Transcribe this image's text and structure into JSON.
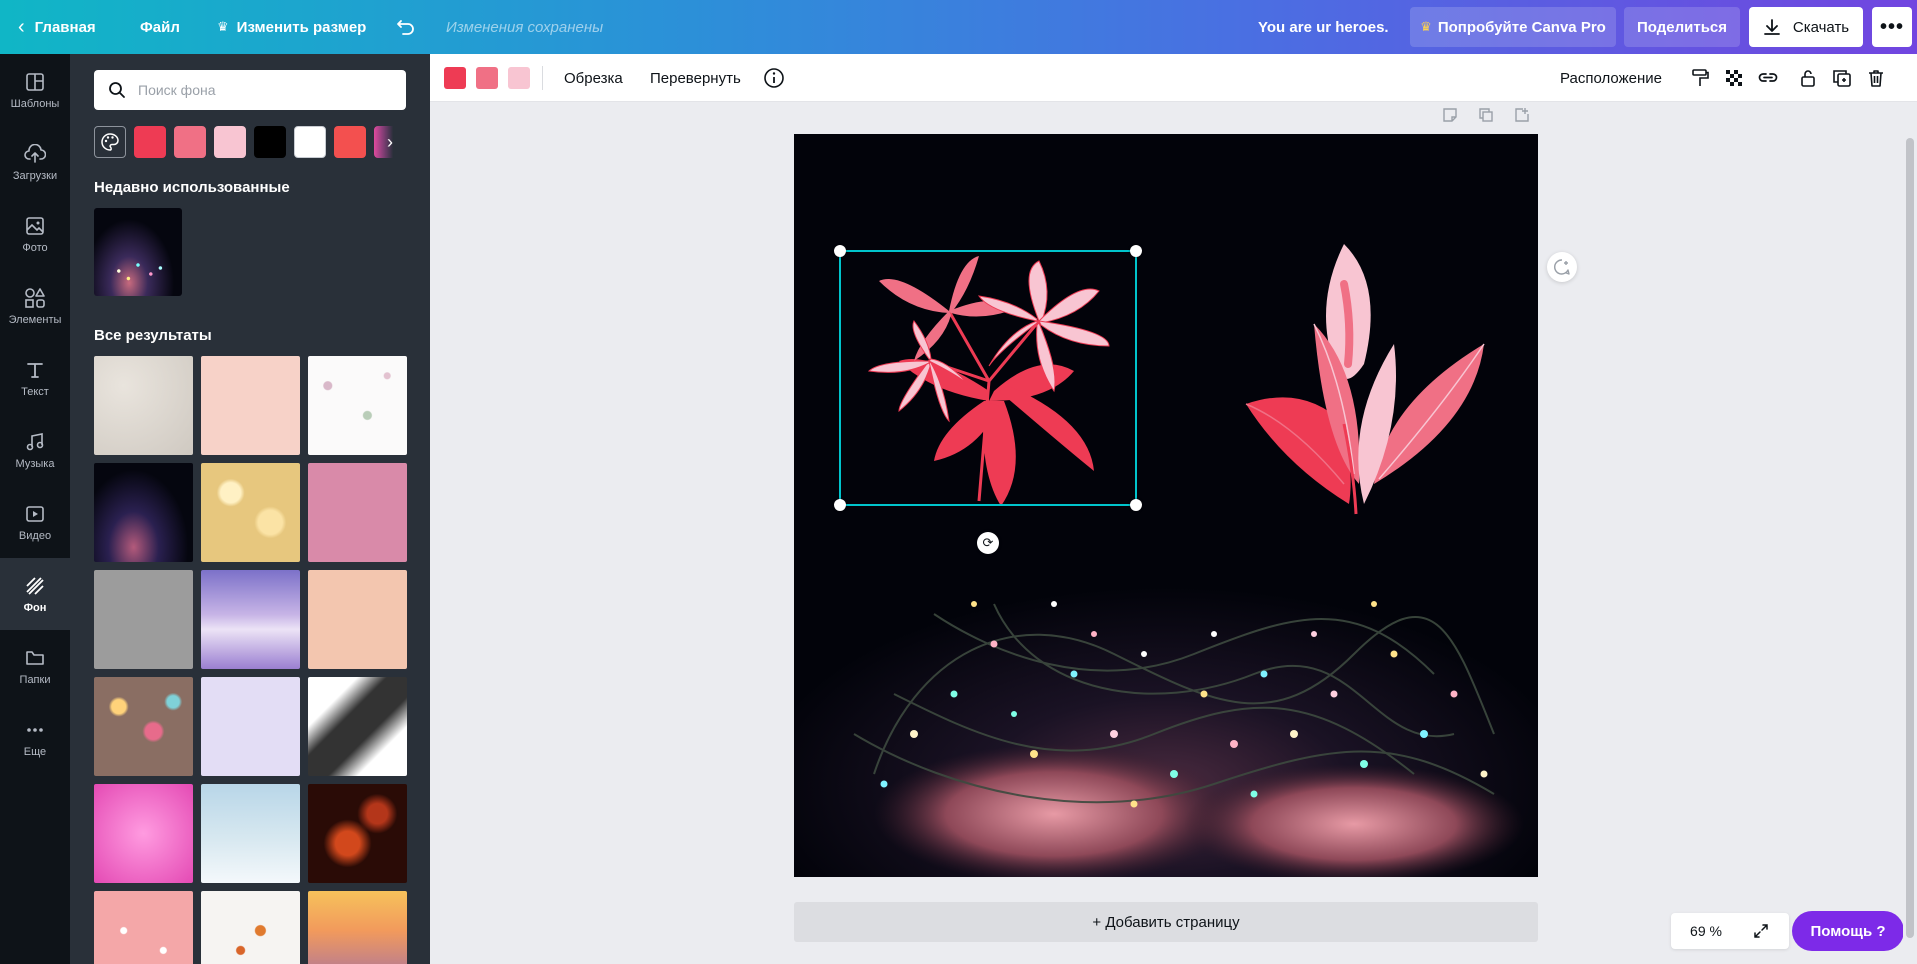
{
  "topbar": {
    "home_label": "Главная",
    "file_label": "Файл",
    "resize_label": "Изменить размер",
    "saved_status": "Изменения сохранены",
    "design_title": "You are ur heroes.",
    "try_pro_label": "Попробуйте Canva Pro",
    "share_label": "Поделиться",
    "download_label": "Скачать"
  },
  "leftnav": {
    "items": [
      {
        "label": "Шаблоны",
        "icon": "templates-icon"
      },
      {
        "label": "Загрузки",
        "icon": "upload-icon"
      },
      {
        "label": "Фото",
        "icon": "photo-icon"
      },
      {
        "label": "Элементы",
        "icon": "elements-icon"
      },
      {
        "label": "Текст",
        "icon": "text-icon"
      },
      {
        "label": "Музыка",
        "icon": "music-icon"
      },
      {
        "label": "Видео",
        "icon": "video-icon"
      },
      {
        "label": "Фон",
        "icon": "background-icon",
        "active": true
      },
      {
        "label": "Папки",
        "icon": "folder-icon"
      },
      {
        "label": "Еще",
        "icon": "more-icon"
      }
    ]
  },
  "panel": {
    "search_placeholder": "Поиск фона",
    "swatches": [
      "#ee3b54",
      "#f07085",
      "#f8c5d2",
      "#000000",
      "#ffffff",
      "#f3504f",
      "#e04a9c"
    ],
    "recent_title": "Недавно использованные",
    "all_title": "Все результаты"
  },
  "context_bar": {
    "colors": [
      "#ee3b54",
      "#f07085",
      "#f8c5d2"
    ],
    "crop_label": "Обрезка",
    "flip_label": "Перевернуть",
    "position_label": "Расположение"
  },
  "canvas": {
    "add_page_label": "+ Добавить страницу",
    "zoom": "69 %",
    "help_label": "Помощь ?"
  },
  "colors": {
    "accent_teal": "#00c4cc",
    "help_purple": "#7d2ae8",
    "panel_bg": "#293039",
    "nav_bg": "#0e1318"
  }
}
